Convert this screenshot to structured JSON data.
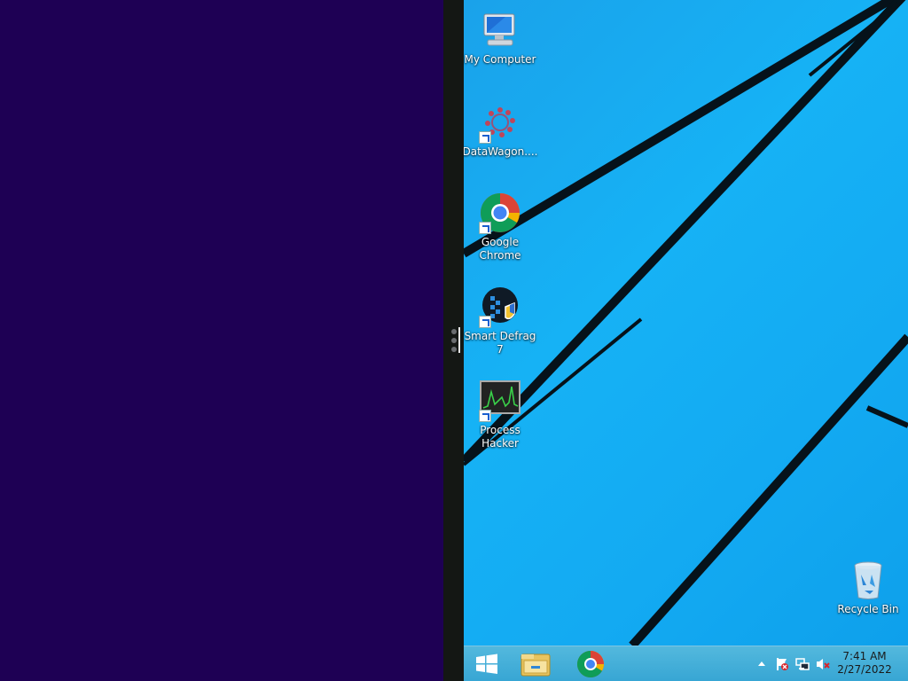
{
  "desktop": {
    "icons": [
      {
        "label": "My Computer",
        "icon": "computer-icon"
      },
      {
        "label": "DataWagon....",
        "icon": "datawagon-icon"
      },
      {
        "label": "Google Chrome",
        "icon": "chrome-icon"
      },
      {
        "label": "Smart Defrag 7",
        "icon": "smart-defrag-icon"
      },
      {
        "label": "Process Hacker",
        "icon": "process-hacker-icon"
      }
    ],
    "recycle_bin": {
      "label": "Recycle Bin",
      "icon": "recycle-bin-icon"
    }
  },
  "taskbar": {
    "start": {
      "icon": "windows-logo-icon"
    },
    "pinned": [
      {
        "icon": "file-explorer-icon"
      },
      {
        "icon": "chrome-icon"
      }
    ],
    "tray": {
      "chevron": "show-hidden-icons-icon",
      "flag": "action-center-flag-icon",
      "network": "network-icon",
      "volume": "volume-muted-icon"
    },
    "clock": {
      "time": "7:41 AM",
      "date": "2/27/2022"
    }
  },
  "colors": {
    "left_pane": "#1e0054",
    "splitter": "#141714",
    "desktop_blue": "#16b2f5"
  }
}
